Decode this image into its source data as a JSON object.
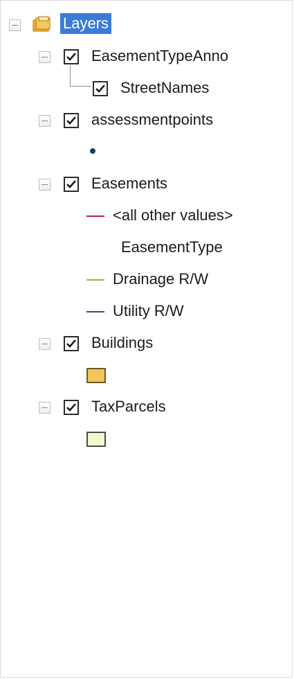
{
  "toc": {
    "root": {
      "label": "Layers",
      "icon": "layers-folder-icon"
    },
    "layers": [
      {
        "label": "EasementTypeAnno",
        "checked": true,
        "children": [
          {
            "label": "StreetNames",
            "checked": true
          }
        ]
      },
      {
        "label": "assessmentpoints",
        "checked": true,
        "symbol": {
          "kind": "point",
          "color": "#1f3b60"
        }
      },
      {
        "label": "Easements",
        "checked": true,
        "legend": {
          "field": "EasementType",
          "items": [
            {
              "label": "<all other values>",
              "color": "#c2185b"
            },
            {
              "label": "Drainage R/W",
              "color": "#b8a05a"
            },
            {
              "label": "Utility R/W",
              "color": "#4a3f8a"
            }
          ]
        }
      },
      {
        "label": "Buildings",
        "checked": true,
        "symbol": {
          "kind": "polygon",
          "fill": "#f2c65a",
          "outline": "#6b5a2a"
        }
      },
      {
        "label": "TaxParcels",
        "checked": true,
        "symbol": {
          "kind": "polygon",
          "fill": "#f4f7c8",
          "outline": "#4b4b4b"
        }
      }
    ]
  },
  "colors": {
    "selection": "#3a7bd5",
    "text": "#1b1b1b"
  }
}
